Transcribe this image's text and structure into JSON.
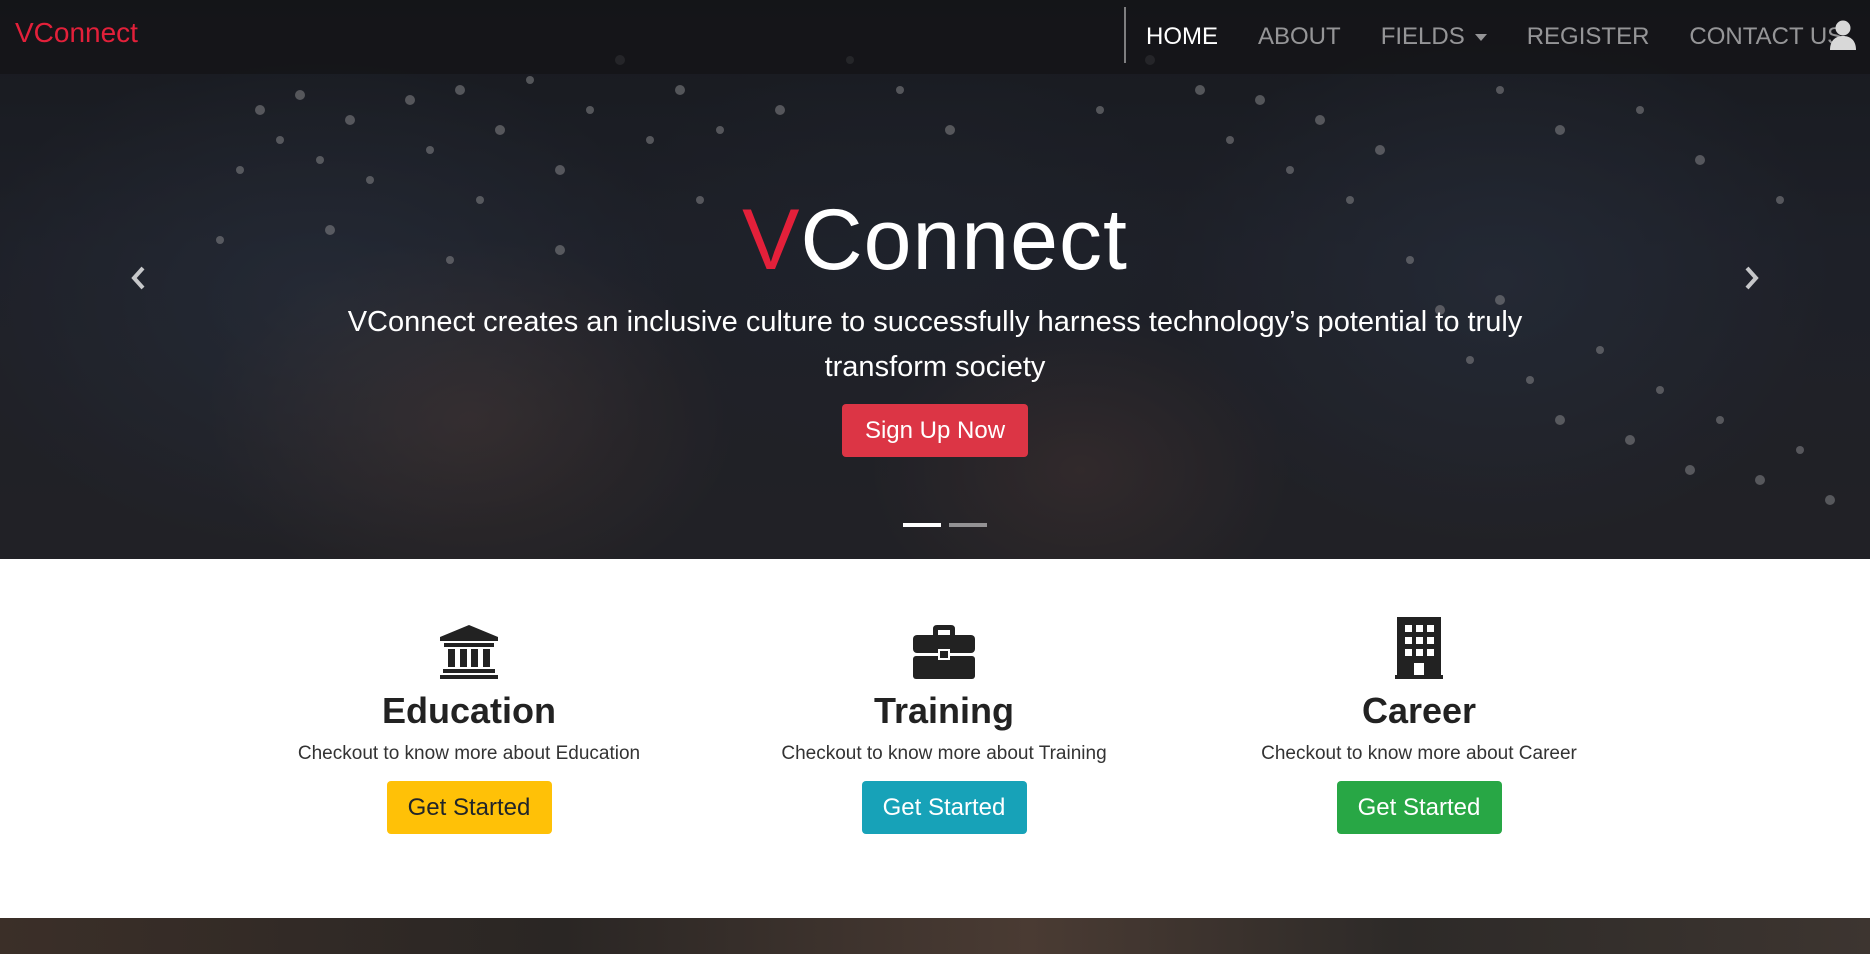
{
  "nav": {
    "brand": "VConnect",
    "links": [
      "HOME",
      "ABOUT",
      "FIELDS",
      "REGISTER",
      "CONTACT US"
    ],
    "active_link": "HOME",
    "icons": {
      "user": "user-icon",
      "fields_dropdown": "caret-down-icon"
    }
  },
  "hero": {
    "title_accent": "V",
    "title_rest": "Connect",
    "text": "VConnect creates an inclusive culture to successfully harness technology’s potential to truly transform society",
    "cta": "Sign Up Now",
    "slide_count": 2,
    "active_slide": 1,
    "icons": {
      "prev": "chevron-left-icon",
      "next": "chevron-right-icon"
    }
  },
  "features": [
    {
      "icon": "university-icon",
      "title": "Education",
      "text": "Checkout to know more about Education",
      "button": "Get Started",
      "button_color": "#ffc107"
    },
    {
      "icon": "briefcase-icon",
      "title": "Training",
      "text": "Checkout to know more about Training",
      "button": "Get Started",
      "button_color": "#17a2b8"
    },
    {
      "icon": "building-icon",
      "title": "Career",
      "text": "Checkout to know more about Career",
      "button": "Get Started",
      "button_color": "#28a745"
    }
  ],
  "colors": {
    "brand": "#e3203a",
    "cta": "#dc3545",
    "navbar": "#141416"
  }
}
